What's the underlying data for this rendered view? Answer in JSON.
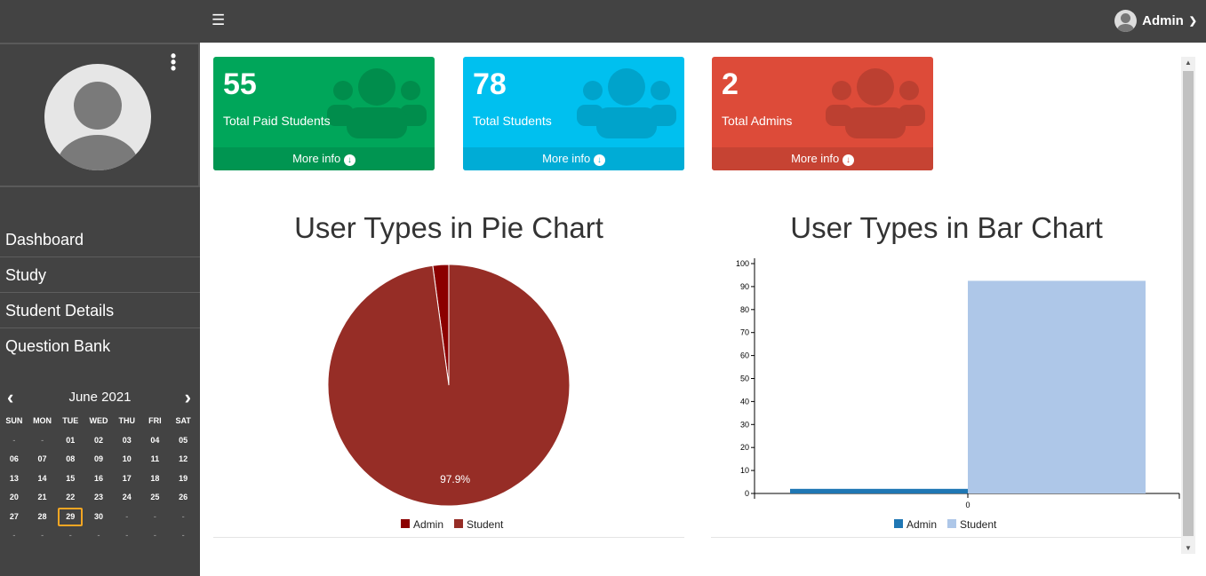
{
  "topbar": {
    "menu_icon": "hamburger-icon",
    "user": "Admin"
  },
  "sidebar": {
    "items": [
      {
        "label": "Dashboard"
      },
      {
        "label": "Study"
      },
      {
        "label": "Student Details"
      },
      {
        "label": "Question Bank"
      }
    ],
    "calendar": {
      "title": "June 2021",
      "weekdays": [
        "SUN",
        "MON",
        "TUE",
        "WED",
        "THU",
        "FRI",
        "SAT"
      ],
      "days": [
        "-",
        "-",
        "01",
        "02",
        "03",
        "04",
        "05",
        "06",
        "07",
        "08",
        "09",
        "10",
        "11",
        "12",
        "13",
        "14",
        "15",
        "16",
        "17",
        "18",
        "19",
        "20",
        "21",
        "22",
        "23",
        "24",
        "25",
        "26",
        "27",
        "28",
        "29",
        "30",
        "-",
        "-",
        "-",
        "-",
        "-",
        "-",
        "-",
        "-",
        "-",
        "-"
      ],
      "today": "29"
    }
  },
  "cards": [
    {
      "value": "55",
      "label": "Total Paid Students",
      "more": "More info",
      "color": "#00a65a",
      "foot": "#009551",
      "icon": "#008d4c"
    },
    {
      "value": "78",
      "label": "Total Students",
      "more": "More info",
      "color": "#00c0ef",
      "foot": "#00acd6",
      "icon": "#00a3cb"
    },
    {
      "value": "2",
      "label": "Total Admins",
      "more": "More info",
      "color": "#dd4b39",
      "foot": "#c64333",
      "icon": "#bc4031"
    }
  ],
  "chart_data": [
    {
      "type": "pie",
      "title": "User Types in Pie Chart",
      "labels": [
        "Admin",
        "Student"
      ],
      "values": [
        2,
        92
      ],
      "colors": [
        "#8b0000",
        "#962d26"
      ],
      "data_labels": [
        "",
        "97.9%"
      ],
      "legend": "bottom"
    },
    {
      "type": "bar",
      "title": "User Types in Bar Chart",
      "categories": [
        "0"
      ],
      "series": [
        {
          "name": "Admin",
          "values": [
            2
          ],
          "color": "#1f77b4"
        },
        {
          "name": "Student",
          "values": [
            92.5
          ],
          "color": "#aec7e8"
        }
      ],
      "ylim": [
        0,
        100
      ],
      "yticks": [
        "0",
        "10",
        "20",
        "30",
        "40",
        "50",
        "60",
        "70",
        "80",
        "90",
        "100"
      ],
      "legend": "bottom"
    }
  ]
}
